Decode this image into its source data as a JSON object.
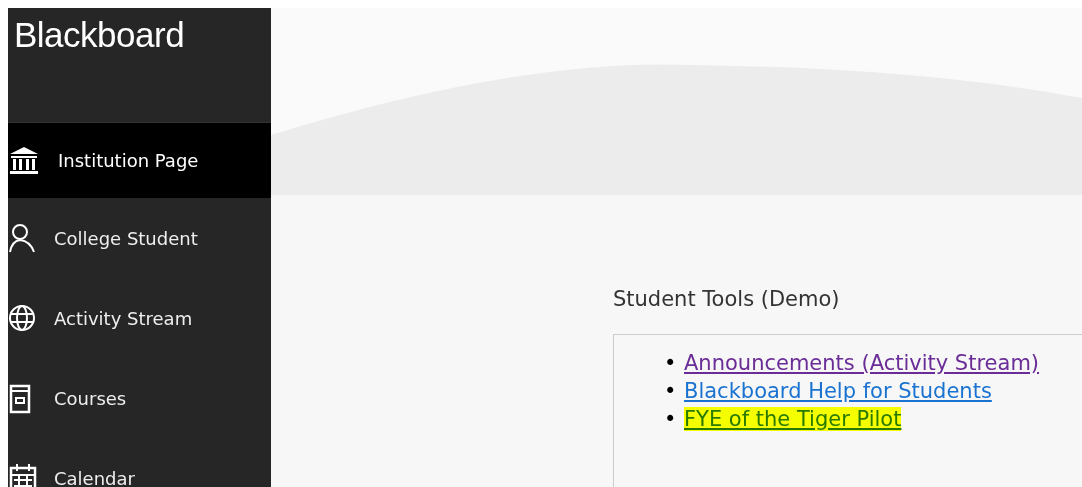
{
  "sidebar": {
    "logo": "Blackboard",
    "items": [
      {
        "label": "Institution Page",
        "selected": true
      },
      {
        "label": "College Student",
        "selected": false
      },
      {
        "label": "Activity Stream",
        "selected": false
      },
      {
        "label": "Courses",
        "selected": false
      },
      {
        "label": "Calendar",
        "selected": false
      }
    ]
  },
  "module": {
    "title": "Student Tools (Demo)",
    "links": [
      {
        "bullet": "•",
        "label": "Announcements (Activity Stream)",
        "visited": true,
        "highlighted": false
      },
      {
        "bullet": "•",
        "label": "Blackboard Help for Students",
        "visited": false,
        "highlighted": false
      },
      {
        "bullet": "•",
        "label": "FYE of the Tiger Pilot",
        "visited": false,
        "highlighted": true
      }
    ]
  }
}
